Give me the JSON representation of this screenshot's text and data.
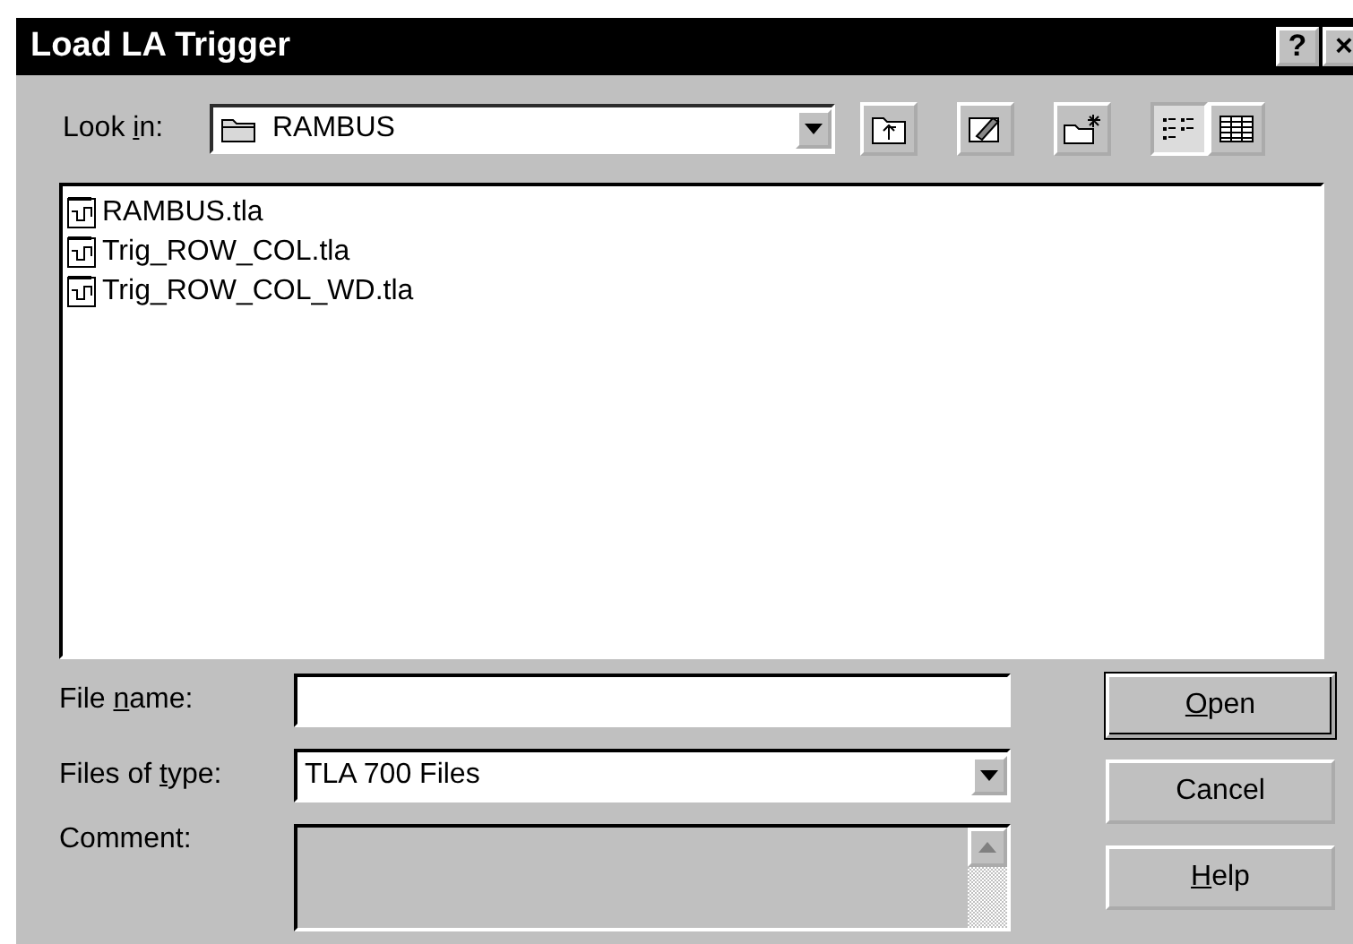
{
  "window": {
    "title": "Load LA Trigger",
    "title_buttons": [
      "?",
      "×"
    ]
  },
  "look_in": {
    "label": {
      "before": "Look ",
      "key": "i",
      "after": "n:"
    },
    "value": "RAMBUS"
  },
  "toolbar": [
    {
      "kind": "up-folder",
      "selected": false
    },
    {
      "kind": "desktop",
      "selected": false
    },
    {
      "kind": "new-folder",
      "selected": false
    },
    {
      "kind": "list-view",
      "selected": true
    },
    {
      "kind": "details-view",
      "selected": false
    }
  ],
  "files": [
    "RAMBUS.tla",
    "Trig_ROW_COL.tla",
    "Trig_ROW_COL_WD.tla"
  ],
  "file_name": {
    "label": {
      "before": "File ",
      "key": "n",
      "after": "ame:"
    }
  },
  "file_type": {
    "label": {
      "before": "Files of ",
      "key": "t",
      "after": "ype:"
    },
    "value": "TLA 700 Files"
  },
  "comment": {
    "label": {
      "before": "Comment:"
    }
  },
  "buttons": [
    {
      "label": {
        "key": "O",
        "after": "pen"
      },
      "default": true
    },
    {
      "label": {
        "before": "Cancel"
      },
      "default": false
    },
    {
      "label": {
        "key": "H",
        "after": "elp"
      },
      "default": false
    }
  ]
}
